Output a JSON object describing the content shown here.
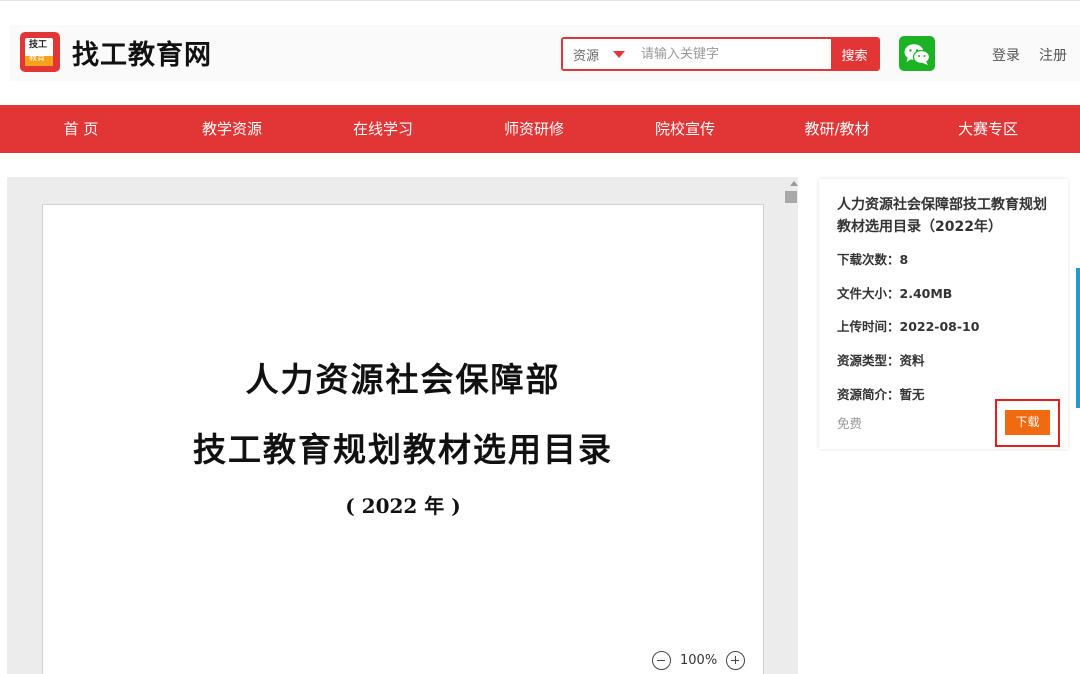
{
  "site": {
    "logo_top": "技工",
    "logo_bottom": "教育",
    "name": "找工教育网"
  },
  "search": {
    "type": "资源",
    "placeholder": "请输入关键字",
    "button": "搜索"
  },
  "auth": {
    "login": "登录",
    "register": "注册"
  },
  "nav": [
    "首 页",
    "教学资源",
    "在线学习",
    "师资研修",
    "院校宣传",
    "教研/教材",
    "大赛专区"
  ],
  "document": {
    "title_line1": "人力资源社会保障部",
    "title_line2": "技工教育规划教材选用目录",
    "year": "( 2022 年 )",
    "zoom": "100%"
  },
  "resource": {
    "title": "人力资源社会保障部技工教育规划教材选用目录（2022年）",
    "downloads": "下载次数：8",
    "size": "文件大小：2.40MB",
    "upload_time": "上传时间：2022-08-10",
    "type": "资源类型：资料",
    "intro": "资源简介：暂无",
    "price": "免费",
    "download": "下载"
  },
  "colors": {
    "brand": "#e23535",
    "download": "#f06a0f",
    "wechat": "#1bb223"
  },
  "icons": [
    "logo-icon",
    "wechat-icon",
    "zoom-out-icon",
    "zoom-in-icon",
    "caret-down-icon"
  ]
}
